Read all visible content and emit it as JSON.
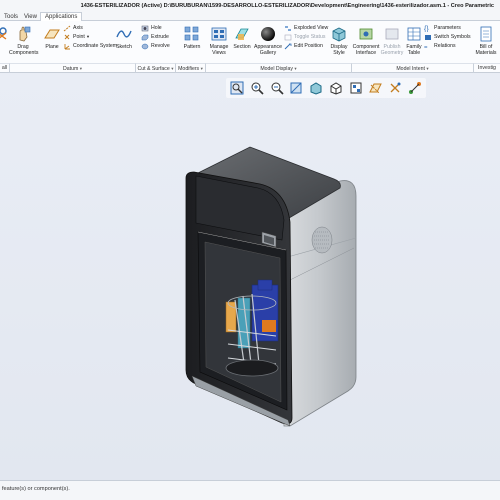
{
  "window": {
    "title": "1436-ESTERILIZADOR (Active) D:\\BURUBURAN\\1599-DESARROLLO-ESTERILIZADOR\\Development\\Engineering\\1436-esterilizador.asm.1 - Creo Parametric"
  },
  "tabs": [
    "Tools",
    "View",
    "Applications"
  ],
  "ribbon": {
    "drag_components": "Drag Components",
    "plane": "Plane",
    "axis": "Axis",
    "point": "Point",
    "coordinate_system": "Coordinate System",
    "sketch": "Sketch",
    "hole": "Hole",
    "extrude": "Extrude",
    "revolve": "Revolve",
    "pattern": "Pattern",
    "manage_views": "Manage Views",
    "section": "Section",
    "appearance_gallery": "Appearance Gallery",
    "exploded_view": "Exploded View",
    "toggle_status": "Toggle Status",
    "edit_position": "Edit Position",
    "display_style": "Display Style",
    "component_interface": "Component Interface",
    "publish_geometry": "Publish Geometry",
    "family_table": "Family Table",
    "parameters": "Parameters",
    "switch_symbols": "Switch Symbols",
    "relations": "Relations",
    "bill_of_materials": "Bill of Materials"
  },
  "groups": {
    "operations": "all",
    "datum": "Datum",
    "cut_surface": "Cut & Surface",
    "modifiers": "Modifiers",
    "model_display": "Model Display",
    "model_intent": "Model Intent",
    "investigate": "Investig"
  },
  "colors": {
    "accent": "#2f6db5",
    "viewport_bg": "#e6ebf3",
    "housing_light": "#c9cdd2",
    "housing_dark": "#2b2d31",
    "load_blue": "#2a3fa8"
  },
  "view_toolbar": [
    "refit-icon",
    "zoom-in-icon",
    "zoom-out-icon",
    "repaint-icon",
    "display-style-icon",
    "saved-orientations-icon",
    "view-manager-icon",
    "datum-display-icon",
    "spin-center-icon",
    "annotation-display-icon"
  ],
  "status": {
    "message": "feature(s) or component(s)."
  }
}
